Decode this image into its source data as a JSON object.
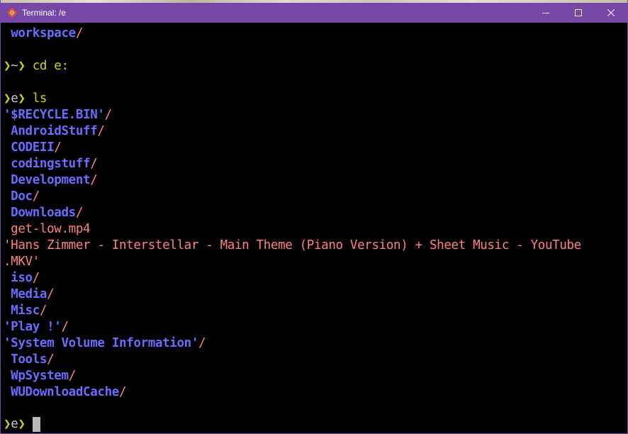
{
  "window": {
    "title": "Terminal: /e",
    "icons": {
      "app": "git-diamond-icon",
      "minimize": "minimize-icon",
      "maximize": "maximize-icon",
      "close": "close-icon"
    },
    "colors": {
      "titlebar": "#7747a7",
      "background": "#000000",
      "directory": "#6b6bff",
      "file": "#ff8080",
      "prompt": "#d4d400"
    }
  },
  "terminal": {
    "prompt_arrow": "❯",
    "lines": {
      "l0_name": "workspace",
      "l0_sep": "/",
      "p1_path": "~",
      "p1_cmd": "cd e:",
      "p2_path": "e",
      "p2_cmd": "ls",
      "final_path": "e"
    },
    "listing": [
      {
        "name": "'$RECYCLE.BIN'",
        "suffix": "/"
      },
      {
        "name": " AndroidStuff",
        "suffix": "/"
      },
      {
        "name": " CODEII",
        "suffix": "/"
      },
      {
        "name": " codingstuff",
        "suffix": "/"
      },
      {
        "name": " Development",
        "suffix": "/"
      },
      {
        "name": " Doc",
        "suffix": "/"
      },
      {
        "name": " Downloads",
        "suffix": "/"
      },
      {
        "name": " get-low.mp4",
        "suffix": ""
      },
      {
        "name": "'Hans Zimmer - Interstellar - Main Theme (Piano Version) + Sheet Music - YouTube",
        "suffix": ""
      },
      {
        "name": ".MKV'",
        "suffix": ""
      },
      {
        "name": " iso",
        "suffix": "/"
      },
      {
        "name": " Media",
        "suffix": "/"
      },
      {
        "name": " Misc",
        "suffix": "/"
      },
      {
        "name": "'Play !'",
        "suffix": "/"
      },
      {
        "name": "'System Volume Information'",
        "suffix": "/"
      },
      {
        "name": " Tools",
        "suffix": "/"
      },
      {
        "name": " WpSystem",
        "suffix": "/"
      },
      {
        "name": " WUDownloadCache",
        "suffix": "/"
      }
    ]
  }
}
